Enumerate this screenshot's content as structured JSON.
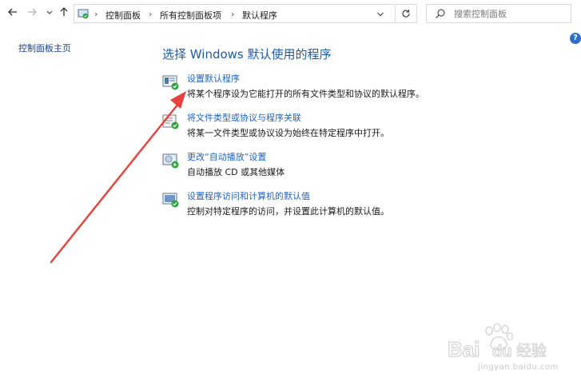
{
  "toolbar": {
    "back_icon": "arrow-left-icon",
    "forward_icon": "arrow-right-icon",
    "recent_icon": "chevron-down-icon",
    "up_icon": "arrow-up-icon",
    "refresh_icon": "refresh-icon"
  },
  "address": {
    "crumbs": [
      "控制面板",
      "所有控制面板项",
      "默认程序"
    ]
  },
  "search": {
    "placeholder": "搜索控制面板"
  },
  "sidebar": {
    "home_label": "控制面板主页"
  },
  "main": {
    "title": "选择 Windows 默认使用的程序",
    "items": [
      {
        "link": "设置默认程序",
        "desc": "将某个程序设为它能打开的所有文件类型和协议的默认程序。",
        "icon": "default-programs-icon"
      },
      {
        "link": "将文件类型或协议与程序关联",
        "desc": "将某一文件类型或协议设为始终在特定程序中打开。",
        "icon": "file-association-icon"
      },
      {
        "link": "更改“自动播放”设置",
        "desc": "自动播放 CD 或其他媒体",
        "icon": "autoplay-icon"
      },
      {
        "link": "设置程序访问和计算机的默认值",
        "desc": "控制对特定程序的访问，并设置此计算机的默认值。",
        "icon": "program-access-icon"
      }
    ]
  },
  "watermark": {
    "brand": "Bai",
    "brand_tail": "经验",
    "url": "jingyan.baidu.com"
  },
  "colors": {
    "link": "#1f63c4",
    "title": "#1e5aa8",
    "annotation_arrow": "#e8403a",
    "help": "#2a6fc9"
  }
}
